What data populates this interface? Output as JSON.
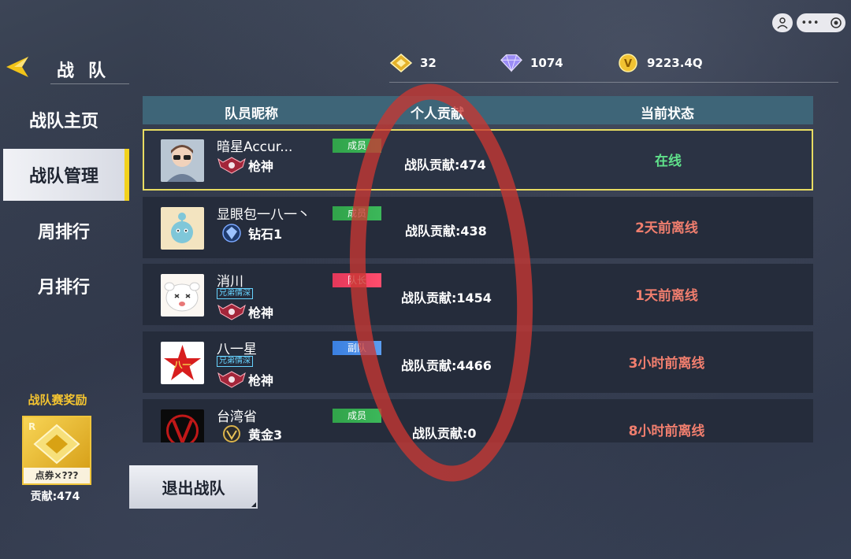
{
  "header": {
    "title": "战队",
    "back_icon": "back-arrow-icon"
  },
  "resources": [
    {
      "icon": "coupon-icon",
      "value": "32"
    },
    {
      "icon": "diamond-icon",
      "value": "1074"
    },
    {
      "icon": "gold-coin-icon",
      "value": "9223.4Q"
    }
  ],
  "menu": {
    "items": [
      {
        "label": "战队主页",
        "active": false
      },
      {
        "label": "战队管理",
        "active": true
      },
      {
        "label": "周排行",
        "active": false
      },
      {
        "label": "月排行",
        "active": false
      }
    ]
  },
  "table": {
    "headers": [
      "队员昵称",
      "个人贡献",
      "当前状态"
    ],
    "rows": [
      {
        "nickname": "暗星Accur...",
        "tag": "",
        "role": "成员",
        "role_color": "green",
        "rank": "枪神",
        "contribution": "战队贡献:474",
        "status": "在线",
        "status_type": "online",
        "selected": true
      },
      {
        "nickname": "显眼包一八一丶",
        "tag": "",
        "role": "成员",
        "role_color": "green",
        "rank": "钻石1",
        "contribution": "战队贡献:438",
        "status": "2天前离线",
        "status_type": "offline",
        "selected": false
      },
      {
        "nickname": "消川",
        "tag": "兄弟情深",
        "role": "队长",
        "role_color": "red",
        "rank": "枪神",
        "contribution": "战队贡献:1454",
        "status": "1天前离线",
        "status_type": "offline",
        "selected": false
      },
      {
        "nickname": "八一星",
        "tag": "兄弟情深",
        "role": "副队",
        "role_color": "blue",
        "rank": "枪神",
        "contribution": "战队贡献:4466",
        "status": "3小时前离线",
        "status_type": "offline",
        "selected": false
      },
      {
        "nickname": "台湾省",
        "tag": "",
        "role": "成员",
        "role_color": "green",
        "rank": "黄金3",
        "contribution": "战队贡献:0",
        "status": "8小时前离线",
        "status_type": "offline",
        "selected": false
      }
    ]
  },
  "reward": {
    "title": "战队赛奖励",
    "item_caption": "点券×???",
    "contribution": "贡献:474"
  },
  "exit_button": "退出战队",
  "colors": {
    "accent_yellow": "#f2d21c",
    "online": "#5fe08a",
    "offline": "#f07e6e",
    "header_bg": "#3e6578"
  }
}
